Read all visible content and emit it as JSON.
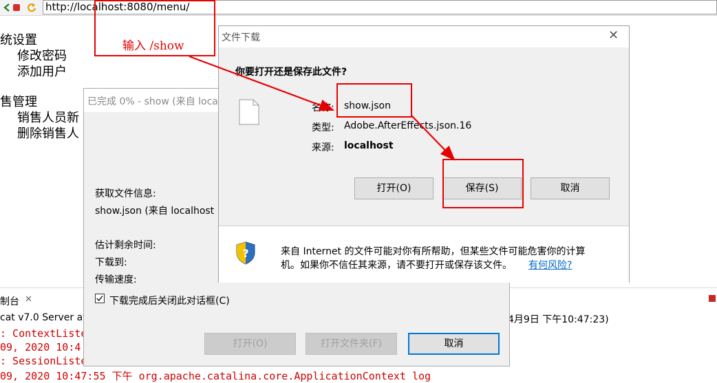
{
  "browser": {
    "url": "http://localhost:8080/menu/",
    "icons": [
      "back-icon",
      "stop-icon",
      "refresh-icon"
    ]
  },
  "menu": {
    "section1": "统设置",
    "item1": "修改密码",
    "item2": "添加用户",
    "section2": "售管理",
    "item3": "销售人员新",
    "item4": "删除销售人"
  },
  "annotation": {
    "hint": "输入 /show"
  },
  "console": {
    "tab_label": "制台",
    "server_line": "cat v7.0 Server at",
    "server_time": "4月9日 下午10:47:23)",
    "log_lines": [
      ": ContextListe",
      "09, 2020 10:4",
      ": SessionListe",
      "09, 2020 10:47:55 下午 org.apache.catalina.core.ApplicationContext log"
    ]
  },
  "progress_dialog": {
    "title": "已完成 0% - show (来自 loca",
    "info_label": "获取文件信息:",
    "file_line": "show.json (来自 localhost",
    "time_left_label": "估计剩余时间:",
    "download_to_label": "下载到:",
    "speed_label": "传输速度:",
    "close_checkbox_label": "下载完成后关闭此对话框(C)",
    "close_checked": true,
    "open_button": "打开(O)",
    "open_folder_button": "打开文件夹(F)",
    "cancel_button": "取消"
  },
  "download_dialog": {
    "title": "文件下载",
    "question": "你要打开还是保存此文件?",
    "name_label": "名称:",
    "name_value": "show.json",
    "type_label": "类型:",
    "type_value": "Adobe.AfterEffects.json.16",
    "from_label": "来源:",
    "from_value": "localhost",
    "open_button": "打开(O)",
    "save_button": "保存(S)",
    "cancel_button": "取消",
    "warning_line1": "来自 Internet 的文件可能对你有所帮助，但某些文件可能危害你的计算",
    "warning_line2": "机。如果你不信任其来源，请不要打开或保存该文件。",
    "risk_link": "有何风险?"
  },
  "colors": {
    "annotation_red": "#e60000",
    "link_blue": "#0066cc",
    "console_error_red": "#d00000"
  }
}
